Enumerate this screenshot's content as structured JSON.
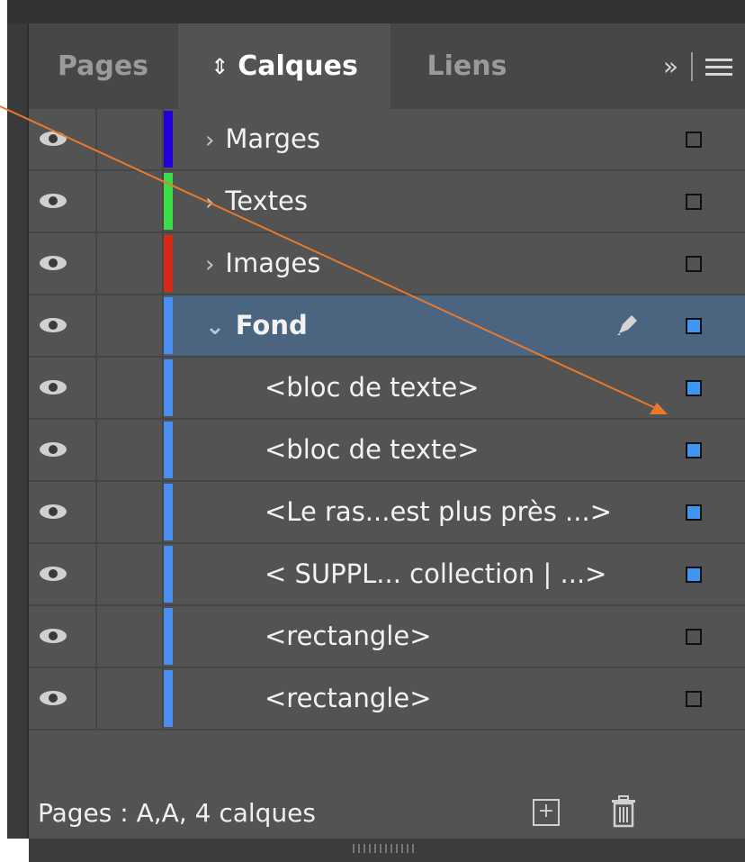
{
  "tabs": [
    {
      "label": "Pages",
      "active": false
    },
    {
      "label": "Calques",
      "icon": "up-down-arrows-icon",
      "active": true
    },
    {
      "label": "Liens",
      "active": false
    }
  ],
  "tab_extras": {
    "overflow_label": "»",
    "menu_icon": "hamburger-menu-icon"
  },
  "layers": [
    {
      "label": "Marges",
      "color": "#2400d8",
      "expanded": false,
      "selected": false,
      "square": "empty"
    },
    {
      "label": "Textes",
      "color": "#3ddc4a",
      "expanded": false,
      "selected": false,
      "square": "empty"
    },
    {
      "label": "Images",
      "color": "#d42a16",
      "expanded": false,
      "selected": false,
      "square": "empty"
    },
    {
      "label": "Fond",
      "color": "#4a8ff0",
      "expanded": true,
      "selected": true,
      "square": "filled"
    }
  ],
  "items": [
    {
      "label": "<bloc de texte>",
      "square": "filled"
    },
    {
      "label": "<bloc de texte>",
      "square": "filled"
    },
    {
      "label": "<Le ras...est plus près ...>",
      "square": "filled"
    },
    {
      "label": "< SUPPL... collection | ...>",
      "square": "filled"
    },
    {
      "label": "<rectangle>",
      "square": "empty"
    },
    {
      "label": "<rectangle>",
      "square": "empty"
    }
  ],
  "footer": {
    "status": "Pages : A,A, 4 calques",
    "add_label": "+"
  },
  "colors": {
    "selection": "#4b6581",
    "accent_square": "#3f96f0",
    "annotation_arrow": "#e8792b"
  }
}
